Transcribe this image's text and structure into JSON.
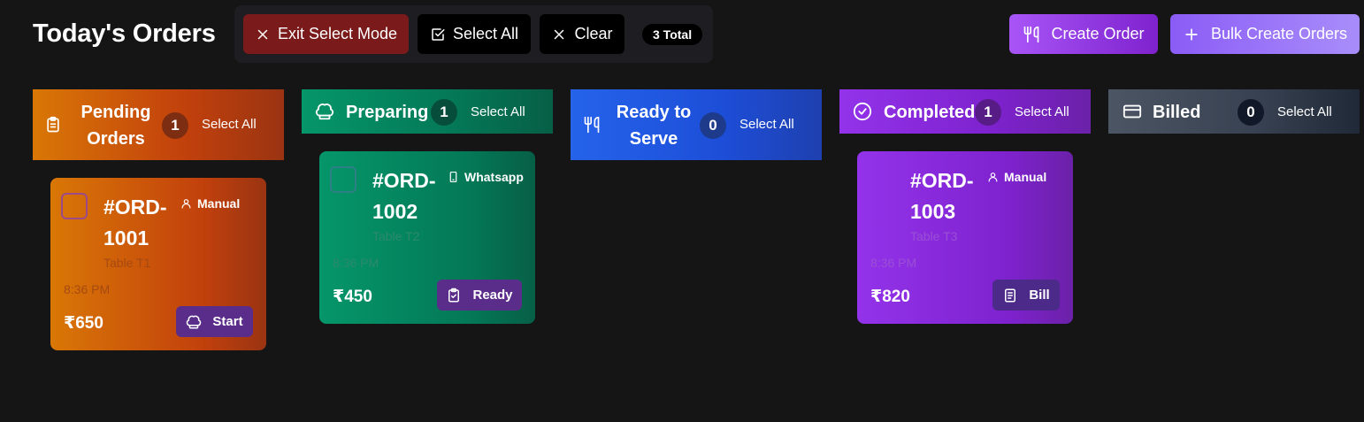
{
  "header": {
    "title": "Today's Orders",
    "exit_select_label": "Exit Select Mode",
    "select_all_label": "Select All",
    "clear_label": "Clear",
    "total_label": "3 Total",
    "create_order_label": "Create Order",
    "bulk_create_label": "Bulk Create Orders"
  },
  "columns": [
    {
      "title": "Pending Orders",
      "count": "1",
      "select_all": "Select All",
      "icon": "clipboard-icon",
      "color": "#d97706"
    },
    {
      "title": "Preparing",
      "count": "1",
      "select_all": "Select All",
      "icon": "chef-hat-icon",
      "color": "#059669"
    },
    {
      "title": "Ready to Serve",
      "count": "0",
      "select_all": "Select All",
      "icon": "utensils-icon",
      "color": "#2563eb"
    },
    {
      "title": "Completed",
      "count": "1",
      "select_all": "Select All",
      "icon": "check-circle-icon",
      "color": "#9333ea"
    },
    {
      "title": "Billed",
      "count": "0",
      "select_all": "Select All",
      "icon": "credit-card-icon",
      "color": "#4b5563"
    }
  ],
  "orders": [
    {
      "id": "#ORD-1001",
      "source": "Manual",
      "source_icon": "user-icon",
      "table": "Table T1",
      "time": "8:36 PM",
      "price": "₹650",
      "action": "Start",
      "action_icon": "chef-hat-icon"
    },
    {
      "id": "#ORD-1002",
      "source": "Whatsapp",
      "source_icon": "phone-icon",
      "table": "Table T2",
      "time": "8:36 PM",
      "price": "₹450",
      "action": "Ready",
      "action_icon": "clipboard-check-icon"
    },
    {
      "id": "#ORD-1003",
      "source": "Manual",
      "source_icon": "user-icon",
      "table": "Table T3",
      "time": "8:36 PM",
      "price": "₹820",
      "action": "Bill",
      "action_icon": "receipt-icon"
    }
  ]
}
